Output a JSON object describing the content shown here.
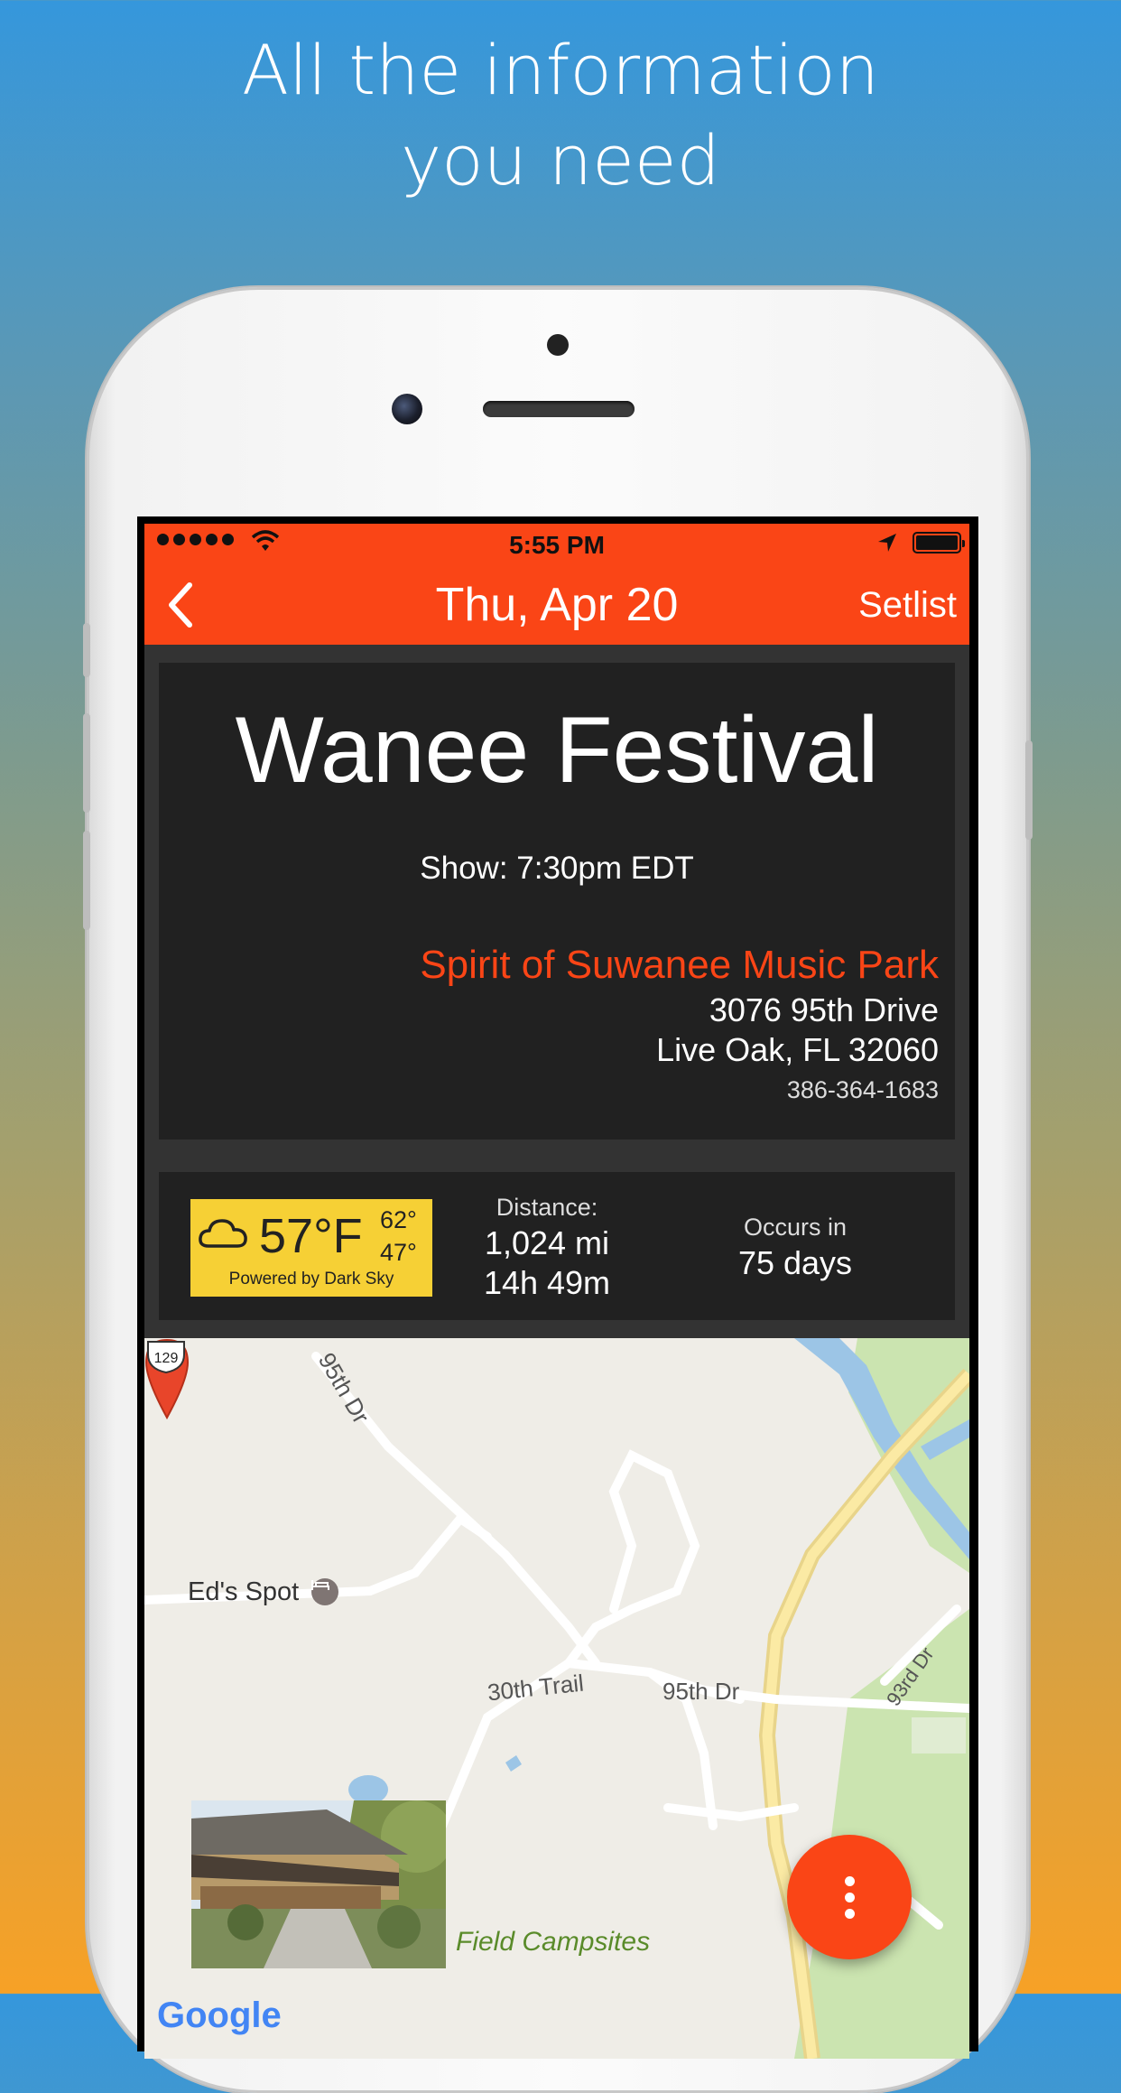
{
  "headline": {
    "line1": "All the information",
    "line2": "you need"
  },
  "status_bar": {
    "time": "5:55 PM"
  },
  "nav": {
    "title": "Thu, Apr 20",
    "setlist_label": "Setlist"
  },
  "event": {
    "name": "Wanee Festival",
    "show_time": "Show: 7:30pm EDT",
    "venue": "Spirit of Suwanee Music Park",
    "address_line1": "3076 95th Drive",
    "address_line2": "Live Oak, FL 32060",
    "phone": "386-364-1683"
  },
  "weather": {
    "temp": "57°F",
    "high": "62°",
    "low": "47°",
    "powered_by": "Powered by Dark Sky",
    "icon": "cloud-icon"
  },
  "distance": {
    "label": "Distance:",
    "miles": "1,024 mi",
    "drive_time": "14h 49m"
  },
  "occurs": {
    "label": "Occurs in",
    "value": "75 days"
  },
  "map": {
    "labels": {
      "eds_spot": "Ed's Spot",
      "trail_30th": "30th Trail",
      "dr_95th": "95th Dr",
      "dr_95th_top": "95th Dr",
      "dr_93rd": "93rd Dr",
      "field_campsites": "Field Campsites",
      "highway": "129"
    },
    "attribution": "Google"
  },
  "colors": {
    "accent": "#fa4516",
    "card": "#212121",
    "weather_bg": "#f6d035"
  }
}
